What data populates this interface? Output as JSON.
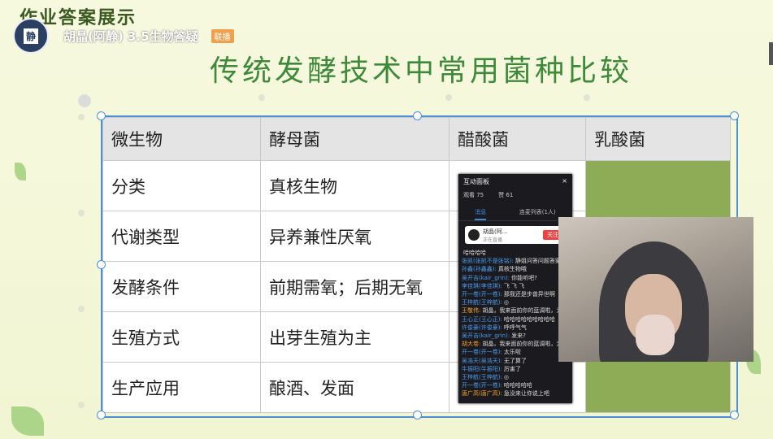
{
  "slide": {
    "top_title": "作业答案展示",
    "main_title": "传统发酵技术中常用菌种比较"
  },
  "presenter": {
    "avatar_char": "静",
    "name": "胡晶(阿静) 3.5生物答疑",
    "badge": "联播"
  },
  "table": {
    "headers": [
      "微生物",
      "酵母菌",
      "醋酸菌",
      "乳酸菌"
    ],
    "rows": [
      [
        "分类",
        "真核生物"
      ],
      [
        "代谢类型",
        "异养兼性厌氧"
      ],
      [
        "发酵条件",
        "前期需氧；后期无氧"
      ],
      [
        "生殖方式",
        "出芽生殖为主"
      ],
      [
        "生产应用",
        "酿酒、发面"
      ]
    ]
  },
  "chat": {
    "title": "互动面板",
    "close": "×",
    "viewers": "观看 75",
    "likes": "赞 61",
    "tabs": [
      "消息",
      "连麦列表(1人)"
    ],
    "card_name": "胡晶(阿...",
    "card_sub": "正在直播",
    "follow_label": "关注",
    "messages": [
      {
        "user": "",
        "text": "哈哈哈哈"
      },
      {
        "user": "张凯(张凯不是张铭):",
        "text": "静姐问答问题答案老师"
      },
      {
        "user": "孙鑫(孙鑫鑫):",
        "text": "真核生物哦"
      },
      {
        "user": "吴开吉(kair_grin):",
        "text": "你能听吧?"
      },
      {
        "user": "李佳琪(李佳琪):",
        "text": "飞 飞 飞"
      },
      {
        "user": "开一卷(开一卷):",
        "text": "那我还是步兽异世啊"
      },
      {
        "user": "王梓航(王梓航):",
        "text": "◎"
      },
      {
        "user": "王敬伟:",
        "text": "胡晶，我来面前你的蓝调啦，为你"
      },
      {
        "user": "王心正(王心正):",
        "text": "哈哈哈哈哈哈哈哈哈"
      },
      {
        "user": "许俊豪(许俊豪):",
        "text": "呼呼气气"
      },
      {
        "user": "吴开吉(kair_grin):",
        "text": "发来?"
      },
      {
        "user": "胡大卷:",
        "text": "胡晶，我来面前你的蓝调啦，为你"
      },
      {
        "user": "开一卷(开一卷):",
        "text": "太乐啦"
      },
      {
        "user": "吴浩天(吴浩天):",
        "text": "无了算了"
      },
      {
        "user": "牛振阳(牛振阳):",
        "text": "厉害了"
      },
      {
        "user": "王梓航(王梓航):",
        "text": "◎"
      },
      {
        "user": "开一卷(开一卷):",
        "text": "哈哈哈哈哈"
      },
      {
        "user": "唐广高(唐广高):",
        "text": "急没来让你说上吧"
      }
    ]
  }
}
